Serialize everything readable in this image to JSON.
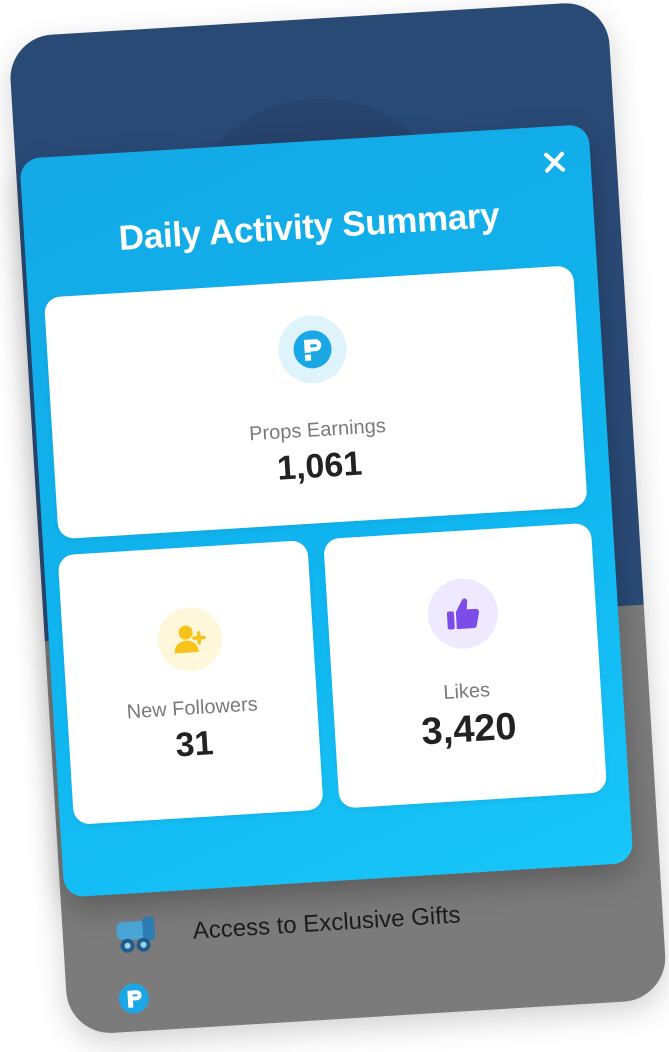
{
  "modal": {
    "title": "Daily Activity Summary",
    "close_symbol": "✕"
  },
  "cards": {
    "props": {
      "label": "Props Earnings",
      "value": "1,061",
      "icon": "props-logo-icon"
    },
    "followers": {
      "label": "New Followers",
      "value": "31",
      "icon": "user-plus-icon"
    },
    "likes": {
      "label": "Likes",
      "value": "3,420",
      "icon": "thumbs-up-icon"
    }
  },
  "background_list": {
    "rows": [
      {
        "label": "Access to Exclusive Gifts",
        "icon": "gift-cannon-icon"
      },
      {
        "label": "",
        "icon": "props-logo-icon"
      }
    ]
  },
  "colors": {
    "phone_top": "#2a4a76",
    "phone_bottom": "#7b7b7b",
    "modal_gradient_start": "#13a9e6",
    "modal_gradient_end": "#18c6f8",
    "props_icon": "#1ba7e6",
    "followers_icon": "#f7c21a",
    "likes_icon": "#7c4ce8"
  }
}
